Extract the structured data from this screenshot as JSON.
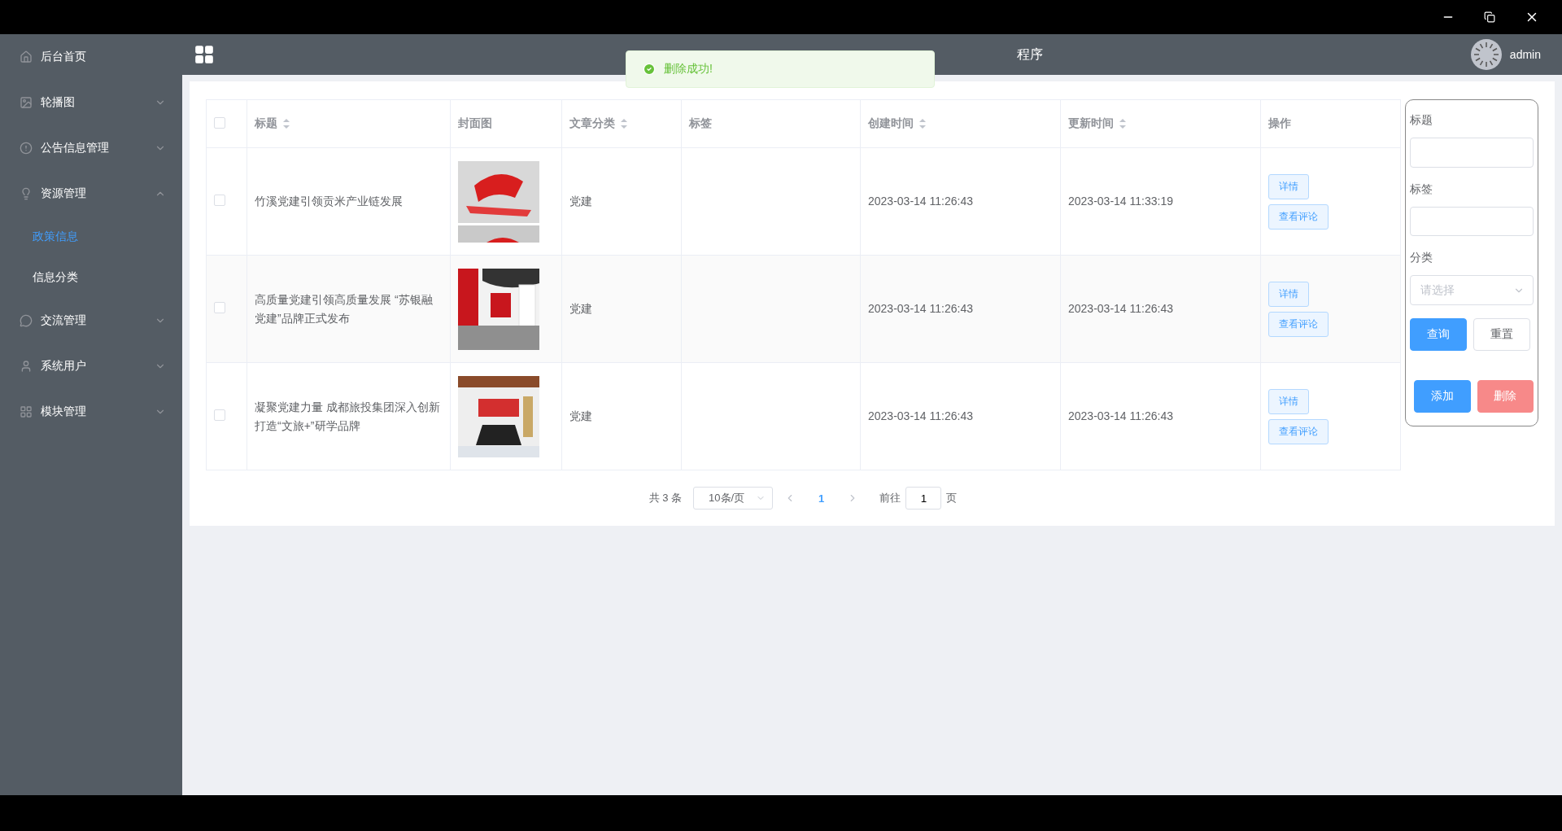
{
  "sidebar": {
    "items": [
      {
        "kind": "link",
        "label": "后台首页"
      },
      {
        "kind": "group",
        "label": "轮播图",
        "expanded": false
      },
      {
        "kind": "group",
        "label": "公告信息管理",
        "expanded": false
      },
      {
        "kind": "group",
        "label": "资源管理",
        "expanded": true,
        "children": [
          {
            "label": "政策信息",
            "selected": true
          },
          {
            "label": "信息分类",
            "selected": false
          }
        ]
      },
      {
        "kind": "group",
        "label": "交流管理",
        "expanded": false
      },
      {
        "kind": "group",
        "label": "系统用户",
        "expanded": false
      },
      {
        "kind": "group",
        "label": "模块管理",
        "expanded": false
      }
    ]
  },
  "header": {
    "title": "程序",
    "user": "admin"
  },
  "toast": {
    "message": "删除成功!"
  },
  "table": {
    "select_all": {
      "checked": false
    },
    "columns": [
      {
        "label": "标题",
        "sortable": true
      },
      {
        "label": "封面图",
        "sortable": false
      },
      {
        "label": "文章分类",
        "sortable": true
      },
      {
        "label": "标签",
        "sortable": false
      },
      {
        "label": "创建时间",
        "sortable": true
      },
      {
        "label": "更新时间",
        "sortable": true
      },
      {
        "label": "操作",
        "sortable": false
      }
    ],
    "rows": [
      {
        "checked": false,
        "title": "竹溪党建引领贡米产业链发展",
        "cover": {
          "kind": "picture"
        },
        "category": "党建",
        "created": "2023-03-14 11:26:43",
        "updated": "2023-03-14 11:33:19",
        "actions": [
          "详情",
          "查看评论"
        ]
      },
      {
        "checked": false,
        "title": "高质量党建引领高质量发展 “苏银融党建”品牌正式发布",
        "cover": {
          "kind": "picture"
        },
        "category": "党建",
        "created": "2023-03-14 11:26:43",
        "updated": "2023-03-14 11:26:43",
        "actions": [
          "详情",
          "查看评论"
        ]
      },
      {
        "checked": false,
        "title": "凝聚党建力量 成都旅投集团深入创新打造“文旅+”研学品牌",
        "cover": {
          "kind": "picture"
        },
        "category": "党建",
        "created": "2023-03-14 11:26:43",
        "updated": "2023-03-14 11:26:43",
        "actions": [
          "详情",
          "查看评论"
        ]
      }
    ]
  },
  "pagination": {
    "total": "共 3 条",
    "page_size": "10条/页",
    "pages": [
      {
        "label": "1",
        "selected": true
      }
    ],
    "goto_label": "前往",
    "goto_value": "1",
    "goto_suffix": "页"
  },
  "filter": {
    "title_label": "标题",
    "tag_label": "标签",
    "category_label": "分类",
    "category_placeholder": "请选择",
    "buttons": [
      {
        "kind": "primary",
        "label": "查询"
      },
      {
        "kind": "plain",
        "label": "重置"
      },
      {
        "kind": "primary",
        "label": "添加"
      },
      {
        "kind": "danger",
        "label": "删除"
      }
    ]
  }
}
